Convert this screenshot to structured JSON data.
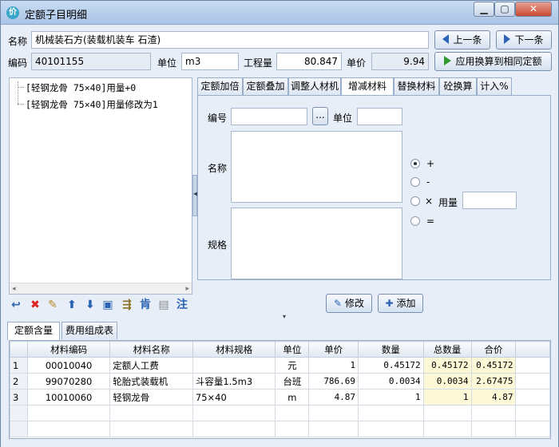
{
  "window": {
    "title": "定额子目明细",
    "icon_glyph": "价",
    "minimize_glyph": "▁",
    "maximize_glyph": "▢",
    "close_glyph": "✕"
  },
  "form": {
    "name_label": "名称",
    "name_value": "机械装石方(装载机装车 石渣)",
    "code_label": "编码",
    "code_value": "40101155",
    "unit_label": "单位",
    "unit_value": "m3",
    "quantity_label": "工程量",
    "quantity_value": "80.847",
    "price_label": "单价",
    "price_value": "9.94",
    "prev_button": "上一条",
    "next_button": "下一条",
    "apply_button": "应用换算到相同定额"
  },
  "tree": {
    "items": [
      {
        "label": "[轻钢龙骨 75×40]用量+0"
      },
      {
        "label": "[轻钢龙骨 75×40]用量修改为1"
      }
    ],
    "scroll_left": "◂",
    "scroll_right": "▸"
  },
  "toolbar": {
    "icons": [
      {
        "name": "undo-icon",
        "glyph": "↩",
        "color": "#2a62b4"
      },
      {
        "name": "delete-icon",
        "glyph": "✖",
        "color": "#d22"
      },
      {
        "name": "broom-icon",
        "glyph": "✎",
        "color": "#b78b2a"
      },
      {
        "name": "move-up-icon",
        "glyph": "⬆",
        "color": "#2a62b4"
      },
      {
        "name": "move-down-icon",
        "glyph": "⬇",
        "color": "#2a62b4"
      },
      {
        "name": "save-icon",
        "glyph": "▣",
        "color": "#2a62b4"
      },
      {
        "name": "replace-icon",
        "glyph": "⇶",
        "color": "#8a6d1f"
      },
      {
        "name": "note-icon",
        "glyph": "肯",
        "color": "#2a62b4"
      },
      {
        "name": "copy-icon",
        "glyph": "▤",
        "color": "#888"
      },
      {
        "name": "annotate-icon",
        "glyph": "注",
        "color": "#2a62b4"
      }
    ]
  },
  "tabs_top": [
    {
      "label": "定额加倍",
      "active": false
    },
    {
      "label": "定额叠加",
      "active": false
    },
    {
      "label": "调整人材机",
      "active": false
    },
    {
      "label": "增减材料",
      "active": true
    },
    {
      "label": "替换材料",
      "active": false
    },
    {
      "label": "砼换算",
      "active": false
    },
    {
      "label": "计入%",
      "active": false
    }
  ],
  "panel": {
    "code_label": "编号",
    "code_value": "",
    "browse_button": "...",
    "unit_label": "单位",
    "unit_value": "",
    "name_label": "名称",
    "spec_label": "规格",
    "radio_plus": "+",
    "radio_minus": "-",
    "radio_times": "×",
    "radio_equal": "=",
    "usage_label": "用量",
    "usage_value": "",
    "modify_button": "修改",
    "add_button": "添加"
  },
  "tabs_bottom": [
    {
      "label": "定额含量",
      "active": true
    },
    {
      "label": "费用组成表",
      "active": false
    }
  ],
  "grid": {
    "columns": [
      "",
      "材料编码",
      "材料名称",
      "材料规格",
      "单位",
      "单价",
      "数量",
      "总数量",
      "合价"
    ],
    "rows": [
      {
        "n": "1",
        "code": "00010040",
        "name": "定额人工费",
        "spec": "",
        "unit": "元",
        "price": "1",
        "qty": "0.45172",
        "total": "0.45172",
        "amount": "0.45172"
      },
      {
        "n": "2",
        "code": "99070280",
        "name": "轮胎式装载机",
        "spec": "斗容量1.5m3",
        "unit": "台班",
        "price": "786.69",
        "qty": "0.0034",
        "total": "0.0034",
        "amount": "2.67475"
      },
      {
        "n": "3",
        "code": "10010060",
        "name": "轻钢龙骨",
        "spec": "75×40",
        "unit": "m",
        "price": "4.87",
        "qty": "1",
        "total": "1",
        "amount": "4.87"
      }
    ]
  },
  "colors": {
    "accent": "#2a62b4",
    "play_green": "#2f9b2f",
    "highlight_yellow": "#fdf8d6"
  }
}
